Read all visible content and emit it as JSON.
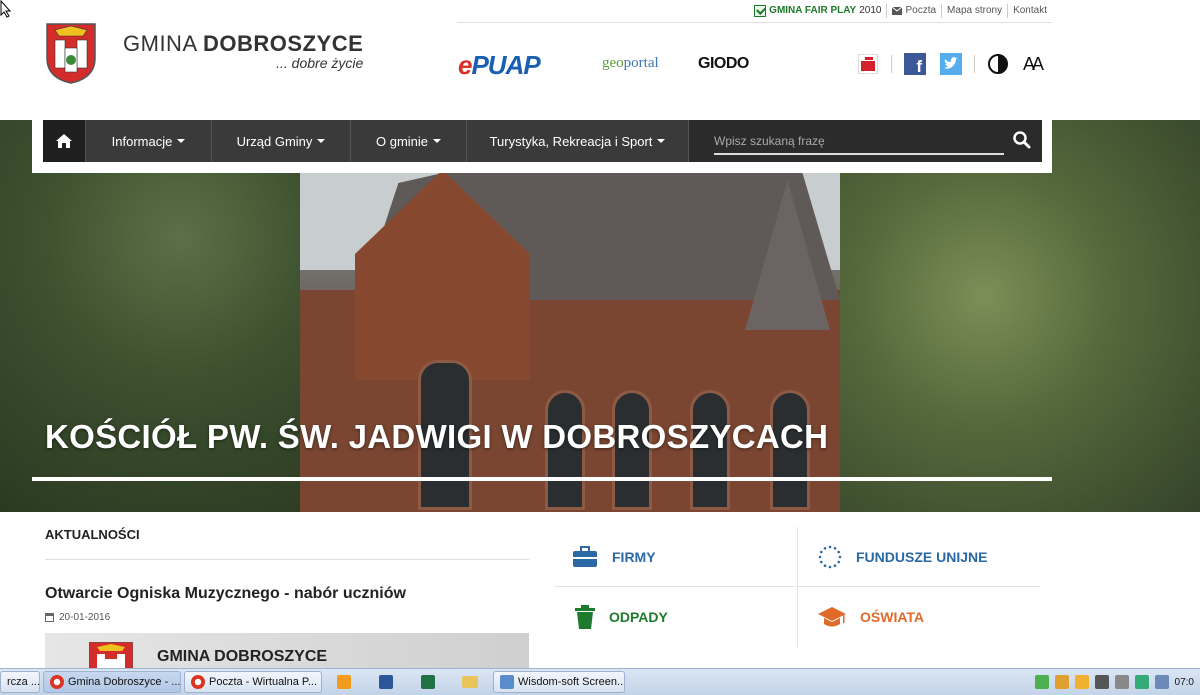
{
  "toplinks": {
    "fairplay": "GMINA FAIR PLAY",
    "fairplay_year": "2010",
    "mail": "Poczta",
    "sitemap": "Mapa strony",
    "contact": "Kontakt"
  },
  "brand": {
    "name_light": "GMINA",
    "name_bold": "DOBROSZYCE",
    "tagline": "... dobre życie"
  },
  "partners": {
    "epuap_e": "e",
    "epuap": "PUAP",
    "geoportal_g": "geo",
    "geoportal": "portal",
    "giodo": "GIODO",
    "facebook_f": "f"
  },
  "nav": {
    "items": [
      {
        "label": "Informacje"
      },
      {
        "label": "Urząd Gminy"
      },
      {
        "label": "O gminie"
      },
      {
        "label": "Turystyka, Rekreacja i Sport"
      }
    ],
    "search_placeholder": "Wpisz szukaną frazę",
    "font_size_label": "AA"
  },
  "hero": {
    "title": "KOŚCIÓŁ PW. ŚW. JADWIGI W DOBROSZYCACH"
  },
  "news": {
    "heading": "AKTUALNOŚCI",
    "items": [
      {
        "title": "Otwarcie Ogniska Muzycznego - nabór uczniów",
        "date": "20-01-2016"
      }
    ],
    "thumb_title": "GMINA DOBROSZYCE"
  },
  "tiles": [
    {
      "label": "FIRMY",
      "color": "#2a69a4"
    },
    {
      "label": "FUNDUSZE UNIJNE",
      "color": "#2a69a4"
    },
    {
      "label": "ODPADY",
      "color": "#1f7a2d"
    },
    {
      "label": "OŚWIATA",
      "color": "#e06a28"
    }
  ],
  "taskbar": {
    "items": [
      {
        "label": "rcza ..."
      },
      {
        "label": "Gmina Dobroszyce - ..."
      },
      {
        "label": "Poczta - Wirtualna P..."
      },
      {
        "label": "Wisdom-soft Screen..."
      }
    ],
    "clock": "07:0"
  }
}
